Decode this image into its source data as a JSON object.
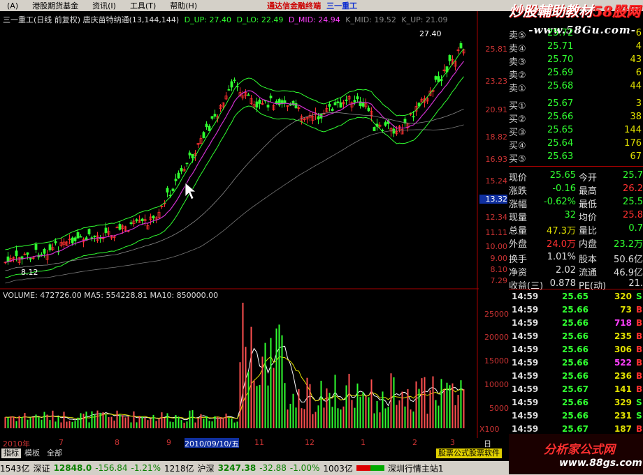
{
  "menu": {
    "items": [
      "(A)",
      "港股期货基金",
      "资讯(I)",
      "工具(T)",
      "帮助(H)"
    ],
    "title": "通达信金融终端",
    "stock": "三一重工"
  },
  "watermark": {
    "top_a": "炒股輔助教材",
    "top_b": "58股网",
    "url": "-www.58Gu.com-"
  },
  "indicator": {
    "name": "三一重工(日线 前复权) 唐庆苗特纳通(13,144,144)",
    "d_up": "D_UP: 27.40",
    "d_lo": "D_LO: 22.49",
    "d_mid": "D_MID: 24.94",
    "k_mid": "K_MID: 19.52",
    "k_up": "K_UP: 21.09"
  },
  "price_axis": [
    "25.81",
    "23.23",
    "20.91",
    "18.82",
    "16.93",
    "15.24",
    "13.32",
    "12.34",
    "11.11",
    "10.00",
    "9.00",
    "8.10",
    "7.29"
  ],
  "price_highlight": "13.32",
  "chart_marks": {
    "high": "27.40",
    "low": "8.12"
  },
  "volume_info": {
    "volume": "VOLUME: 472726.00",
    "ma5": "MA5: 554228.81",
    "ma10": "MA10: 850000.00"
  },
  "vol_axis": [
    "25000",
    "20000",
    "15000",
    "10000",
    "5000"
  ],
  "vol_unit": "X100",
  "order_book": {
    "sell": [
      {
        "label": "卖⑤",
        "price": "25.72",
        "vol": "6"
      },
      {
        "label": "卖④",
        "price": "25.71",
        "vol": "4"
      },
      {
        "label": "卖③",
        "price": "25.70",
        "vol": "43"
      },
      {
        "label": "卖②",
        "price": "25.69",
        "vol": "6"
      },
      {
        "label": "卖①",
        "price": "25.68",
        "vol": "44"
      }
    ],
    "buy": [
      {
        "label": "买①",
        "price": "25.67",
        "vol": "3"
      },
      {
        "label": "买②",
        "price": "25.66",
        "vol": "38"
      },
      {
        "label": "买③",
        "price": "25.65",
        "vol": "144"
      },
      {
        "label": "买④",
        "price": "25.64",
        "vol": "176"
      },
      {
        "label": "买⑤",
        "price": "25.63",
        "vol": "67"
      }
    ]
  },
  "quote_stats": [
    {
      "l1": "现价",
      "v1": "25.65",
      "l2": "今开",
      "v2": "25.7"
    },
    {
      "l1": "涨跌",
      "v1": "-0.16",
      "l2": "最高",
      "v2": "26.2"
    },
    {
      "l1": "涨幅",
      "v1": "-0.62%",
      "l2": "最低",
      "v2": "25.5"
    },
    {
      "l1": "现量",
      "v1": "32",
      "l2": "均价",
      "v2": "25.8"
    },
    {
      "l1": "总量",
      "v1": "47.3万",
      "l2": "量比",
      "v2": "0.7"
    },
    {
      "l1": "外盘",
      "v1": "24.0万",
      "l2": "内盘",
      "v2": "23.2万"
    },
    {
      "l1": "换手",
      "v1": "1.01%",
      "l2": "股本",
      "v2": "50.6亿"
    },
    {
      "l1": "净资",
      "v1": "2.02",
      "l2": "流通",
      "v2": "46.9亿"
    },
    {
      "l1": "收益(三)",
      "v1": "0.878",
      "l2": "PE(动)",
      "v2": "21."
    }
  ],
  "ticks": [
    {
      "time": "14:59",
      "price": "25.65",
      "vol": "320",
      "flag": "S"
    },
    {
      "time": "14:59",
      "price": "25.66",
      "vol": "73",
      "flag": "B"
    },
    {
      "time": "14:59",
      "price": "25.66",
      "vol": "718",
      "flag": "B"
    },
    {
      "time": "14:59",
      "price": "25.66",
      "vol": "235",
      "flag": "B"
    },
    {
      "time": "14:59",
      "price": "25.66",
      "vol": "306",
      "flag": "B"
    },
    {
      "time": "14:59",
      "price": "25.66",
      "vol": "522",
      "flag": "B"
    },
    {
      "time": "14:59",
      "price": "25.66",
      "vol": "236",
      "flag": "B"
    },
    {
      "time": "14:59",
      "price": "25.67",
      "vol": "141",
      "flag": "B"
    },
    {
      "time": "14:59",
      "price": "25.66",
      "vol": "329",
      "flag": "S"
    },
    {
      "time": "14:59",
      "price": "25.66",
      "vol": "231",
      "flag": "S"
    },
    {
      "time": "14:59",
      "price": "25.67",
      "vol": "187",
      "flag": "B"
    }
  ],
  "date_axis": [
    "2010年",
    "7",
    "8",
    "9",
    "2010/09/10/五",
    "11",
    "12",
    "1",
    "2",
    "3",
    "日线"
  ],
  "tabs": [
    "指标",
    "模板",
    "全部"
  ],
  "tab_right": "股票公式股票软件",
  "status": {
    "s1": "1543亿",
    "sz_label": "深证",
    "sz_val": "12848.0",
    "sz_chg": "-156.84",
    "sz_pct": "-1.21%",
    "s2": "1218亿",
    "sh_label": "沪深",
    "sh_val": "3247.38",
    "sh_chg": "-32.88",
    "sh_pct": "-1.00%",
    "s3": "1003亿",
    "station": "深圳行情主站1"
  },
  "logo_bottom": {
    "name": "分析家公式网",
    "url": "www.88gs.com"
  },
  "colors": {
    "up": "#ff3030",
    "down": "#30ff30",
    "mid": "#d030d0",
    "axis": "#cc3333",
    "line": "#ffffff"
  }
}
